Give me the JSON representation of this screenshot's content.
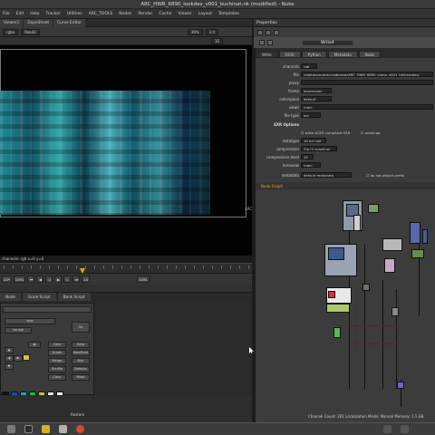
{
  "app": {
    "title": "ARC_HWR_6890_lookdev_v001_kuchinat.nk (modified) - Nuke"
  },
  "menubar": {
    "items": [
      "File",
      "Edit",
      "Help",
      "Tracker",
      "Utilities",
      "ARC_TOOLS",
      "Nodes",
      "Render",
      "Cache",
      "Viewer",
      "Layout",
      "Templates"
    ]
  },
  "viewer_tabs": [
    "Viewer1",
    "DopeSheet",
    "Curve Editor"
  ],
  "viewer_controls": {
    "channels": "rgba",
    "input": "Read3",
    "zoom": "39%",
    "ratio": "1:4",
    "frame_label": "1E"
  },
  "viewer": {
    "edge_label": "ARC",
    "info_text": "channels: rgb   x=0 y=0"
  },
  "playbar": {
    "fps": "24*",
    "frame": "1091",
    "end_frame": "1091",
    "increment": "10"
  },
  "lower_tabs": [
    "Node",
    "Scale Script",
    "Bank Script"
  ],
  "toolset": {
    "selected": "vipo",
    "mode": "normal",
    "rows": [
      [
        "Gain",
        "Roto"
      ],
      [
        "Grade",
        "RotoPaint"
      ],
      [
        "Merge",
        "Blur"
      ],
      [
        "Shuffle",
        "Defocus"
      ],
      [
        "Copy",
        "Mask"
      ]
    ],
    "extra_label": "Go",
    "bottom_label": "Restore"
  },
  "palette": {
    "colors": [
      "#111111",
      "#1e4ea8",
      "#1fa0c8",
      "#1fb84a",
      "#c8c820",
      "#e0e0e0",
      "#f0f0f0"
    ]
  },
  "properties": {
    "panel_title": "Properties",
    "node_name": "Write4",
    "tabs": [
      "Write",
      "OCIO",
      "Python",
      "Metadata",
      "Node"
    ],
    "selected_tab": "Write",
    "fields": [
      {
        "key": "channels",
        "value": "rgb"
      },
      {
        "key": "file",
        "value": "/digital/projects/radbreak/ARC_HWR_6890_comp_v001_LW/renders/"
      },
      {
        "key": "proxy",
        "value": ""
      },
      {
        "key": "frame",
        "value": "expression"
      },
      {
        "key": "colorspace",
        "value": "default"
      },
      {
        "key": "views",
        "value": "main"
      },
      {
        "key": "file type",
        "value": "exr"
      }
    ],
    "exr_options_label": "EXR Options",
    "exr_flags": [
      "write ACES compliant EXR",
      "autocrop"
    ],
    "exr_fields": [
      {
        "key": "datatype",
        "value": "16 bit half"
      },
      {
        "key": "compression",
        "value": "Zip (1 scanline)"
      },
      {
        "key": "compression level",
        "value": "45"
      },
      {
        "key": "heroview",
        "value": "main"
      },
      {
        "key": "metadata",
        "value": "default metadata"
      }
    ],
    "metadata_flag": "do not attach prefix"
  },
  "nodegraph": {
    "title": "Node Graph",
    "status": "Channel Count: 261  Localization Mode: Manual  Memory: 1.1 GB"
  },
  "taskbar": {
    "icons": [
      "app-menu-icon",
      "terminal-icon",
      "nuke-icon",
      "files-icon",
      "chrome-icon"
    ],
    "colors": [
      "#7a7a7a",
      "#2a2a2a",
      "#d9b020",
      "#b0b0b0",
      "#d84a30"
    ]
  }
}
